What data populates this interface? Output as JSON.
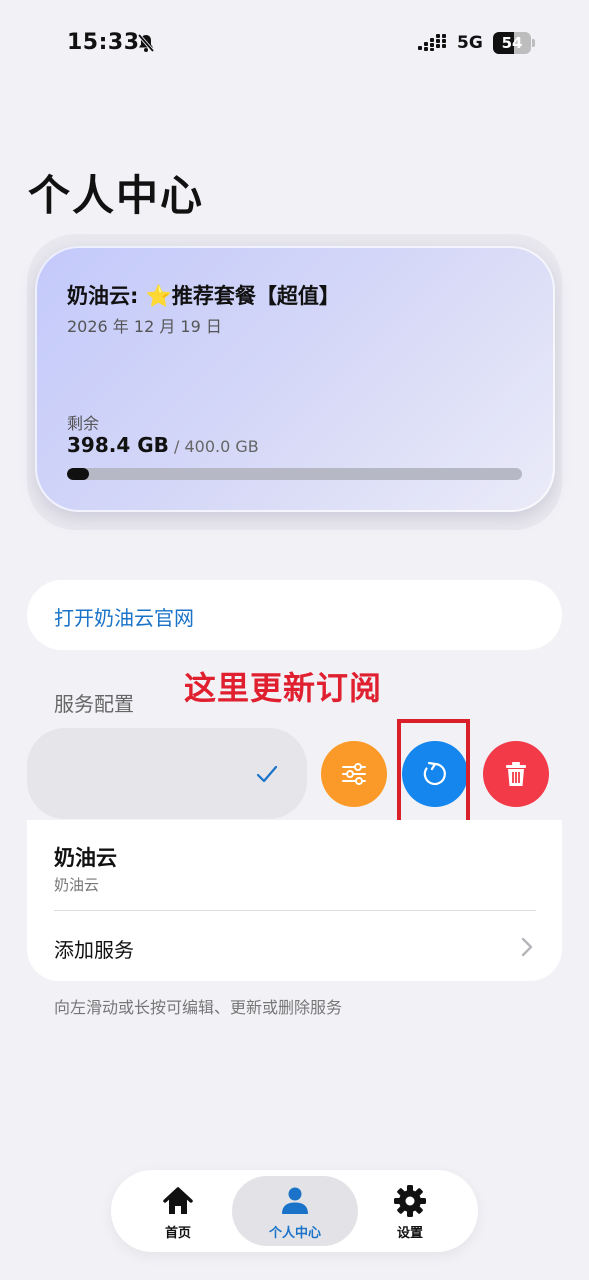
{
  "status_bar": {
    "time": "15:33",
    "network": "5G",
    "battery": "54",
    "battery_level": 0.54
  },
  "page": {
    "title": "个人中心"
  },
  "plan_card": {
    "title": "奶油云: ⭐推荐套餐【超值】",
    "date": "2026 年 12 月 19 日",
    "remaining_label": "剩余",
    "remaining_value": "398.4 GB",
    "total": " / 400.0 GB",
    "used_fraction": 0.004
  },
  "website_link": {
    "label": "打开奶油云官网"
  },
  "annotation": {
    "text": "这里更新订阅"
  },
  "services": {
    "section_label": "服务配置",
    "items": [
      {
        "name": "奶油云",
        "subtitle": "奶油云"
      }
    ],
    "add_label": "添加服务",
    "hint": "向左滑动或长按可编辑、更新或删除服务",
    "actions": {
      "edit_icon": "sliders-icon",
      "refresh_icon": "refresh-icon",
      "delete_icon": "trash-icon"
    }
  },
  "tab_bar": {
    "tabs": [
      {
        "label": "首页",
        "icon": "home-icon"
      },
      {
        "label": "个人中心",
        "icon": "person-icon",
        "active": true
      },
      {
        "label": "设置",
        "icon": "gear-icon"
      }
    ]
  },
  "colors": {
    "accent": "#1a73c8",
    "edit": "#fb9a28",
    "refresh": "#1486ee",
    "delete": "#f23a48",
    "annotation": "#e0202f"
  }
}
